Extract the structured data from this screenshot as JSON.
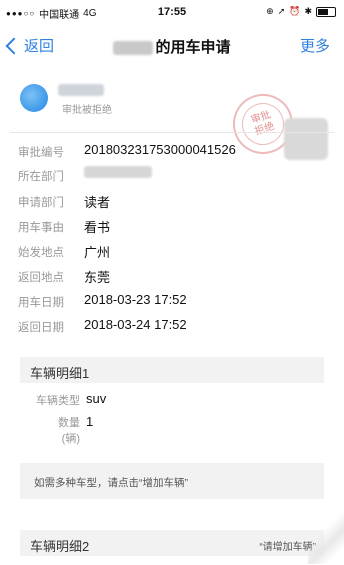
{
  "status_bar": {
    "carrier": "中国联通",
    "network": "4G",
    "time": "17:55",
    "icons": [
      "lock-rotation-icon",
      "location-icon",
      "alarm-icon",
      "bluetooth-icon",
      "battery-icon"
    ]
  },
  "nav": {
    "back_label": "返回",
    "title_suffix": "的用车申请",
    "more_label": "更多"
  },
  "header": {
    "status": "审批被拒绝"
  },
  "stamp": {
    "line1": "审批",
    "line2": "拒绝"
  },
  "details": [
    {
      "label": "审批编号",
      "value": "20180323175300004152​6"
    },
    {
      "label": "所在部门",
      "value": ""
    },
    {
      "label": "申请部门",
      "value": "读者"
    },
    {
      "label": "用车事由",
      "value": "看书"
    },
    {
      "label": "始发地点",
      "value": "广州"
    },
    {
      "label": "返回地点",
      "value": "东莞"
    },
    {
      "label": "用车日期",
      "value": "2018-03-23 17:52"
    },
    {
      "label": "返回日期",
      "value": "2018-03-24 17:52"
    }
  ],
  "vehicle1": {
    "title": "车辆明细1",
    "type_label": "车辆类型",
    "type_value": "suv",
    "qty_label_1": "数量",
    "qty_label_2": "(辆)",
    "qty_value": "1"
  },
  "hint": "如需多种车型，请点击“增加车辆”",
  "vehicle2": {
    "title": "车辆明细2",
    "right_text": "“请增加车辆”"
  },
  "colors": {
    "accent": "#2f80e0",
    "stamp": "#d96b6b",
    "section_bg": "#f2f2f2"
  }
}
